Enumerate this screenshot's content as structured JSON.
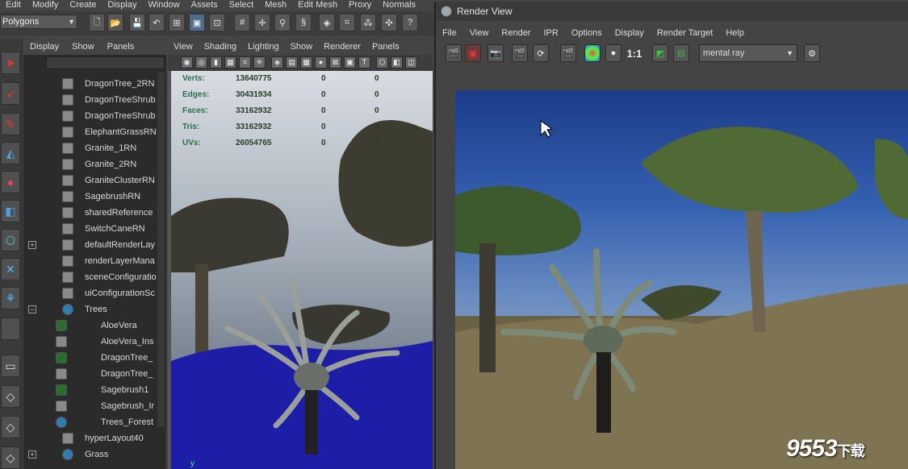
{
  "main_menu": [
    "Edit",
    "Modify",
    "Create",
    "Display",
    "Window",
    "Assets",
    "Select",
    "Mesh",
    "Edit Mesh",
    "Proxy",
    "Normals"
  ],
  "mode_select": {
    "value": "Polygons"
  },
  "outliner": {
    "menu": [
      "Display",
      "Show",
      "Panels"
    ],
    "items": [
      {
        "label": "DragonTree_2RN",
        "icon": "reference-icon",
        "indent": 0
      },
      {
        "label": "DragonTreeShrub",
        "icon": "reference-icon",
        "indent": 0
      },
      {
        "label": "DragonTreeShrub",
        "icon": "reference-icon",
        "indent": 0
      },
      {
        "label": "ElephantGrassRN",
        "icon": "reference-icon",
        "indent": 0
      },
      {
        "label": "Granite_1RN",
        "icon": "reference-icon",
        "indent": 0
      },
      {
        "label": "Granite_2RN",
        "icon": "reference-icon",
        "indent": 0
      },
      {
        "label": "GraniteClusterRN",
        "icon": "reference-icon",
        "indent": 0
      },
      {
        "label": "SagebrushRN",
        "icon": "reference-icon",
        "indent": 0
      },
      {
        "label": "sharedReference",
        "icon": "reference-icon",
        "indent": 0
      },
      {
        "label": "SwitchCaneRN",
        "icon": "reference-icon",
        "indent": 0
      },
      {
        "label": "defaultRenderLay",
        "icon": "render-layer-icon",
        "indent": 0,
        "expander": "+"
      },
      {
        "label": "renderLayerMana",
        "icon": "node-icon",
        "indent": 0
      },
      {
        "label": "sceneConfiguratio",
        "icon": "node-icon",
        "indent": 0
      },
      {
        "label": "uiConfigurationSc",
        "icon": "node-icon",
        "indent": 0
      },
      {
        "label": "Trees",
        "icon": "group-icon",
        "indent": 0,
        "expander": "−"
      },
      {
        "label": "AloeVera",
        "icon": "particle-icon",
        "indent": 1
      },
      {
        "label": "AloeVera_Ins",
        "icon": "instancer-icon",
        "indent": 1
      },
      {
        "label": "DragonTree_",
        "icon": "particle-icon",
        "indent": 1
      },
      {
        "label": "DragonTree_",
        "icon": "instancer-icon",
        "indent": 1
      },
      {
        "label": "Sagebrush1",
        "icon": "particle-icon",
        "indent": 1
      },
      {
        "label": "Sagebrush_Ir",
        "icon": "instancer-icon",
        "indent": 1
      },
      {
        "label": "Trees_Forest",
        "icon": "paint-effects-icon",
        "indent": 1
      },
      {
        "label": "hyperLayout40",
        "icon": "node-icon",
        "indent": 0
      },
      {
        "label": "Grass",
        "icon": "group-icon",
        "indent": 0,
        "expander": "+"
      }
    ]
  },
  "viewport": {
    "menu": [
      "View",
      "Shading",
      "Lighting",
      "Show",
      "Renderer",
      "Panels"
    ],
    "stats": [
      {
        "name": "Verts:",
        "v1": "13640775",
        "v2": "0",
        "v3": "0"
      },
      {
        "name": "Edges:",
        "v1": "30431934",
        "v2": "0",
        "v3": "0"
      },
      {
        "name": "Faces:",
        "v1": "33162932",
        "v2": "0",
        "v3": "0"
      },
      {
        "name": "Tris:",
        "v1": "33162932",
        "v2": "0",
        "v3": "0"
      },
      {
        "name": "UVs:",
        "v1": "26054765",
        "v2": "0",
        "v3": "0"
      }
    ],
    "axis_label": "y"
  },
  "render_view": {
    "title": "Render View",
    "menu": [
      "File",
      "View",
      "Render",
      "IPR",
      "Options",
      "Display",
      "Render Target",
      "Help"
    ],
    "ratio_label": "1:1",
    "renderer": "mental ray"
  },
  "watermark": {
    "text": "9553",
    "suffix": "下载"
  }
}
